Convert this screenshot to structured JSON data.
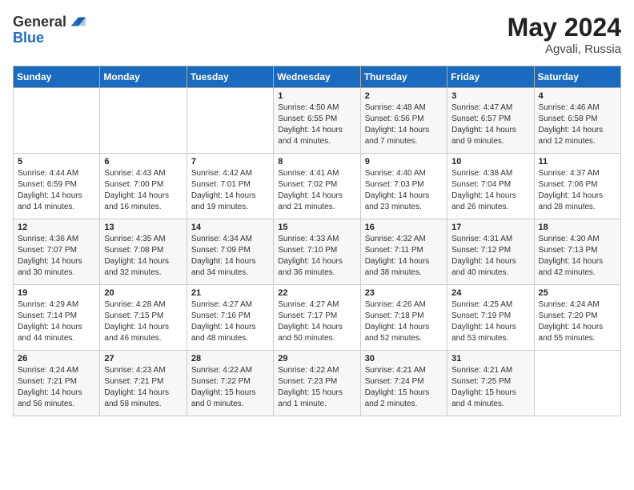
{
  "header": {
    "logo_general": "General",
    "logo_blue": "Blue",
    "title": "May 2024",
    "location": "Agvali, Russia"
  },
  "days_of_week": [
    "Sunday",
    "Monday",
    "Tuesday",
    "Wednesday",
    "Thursday",
    "Friday",
    "Saturday"
  ],
  "weeks": [
    [
      {
        "day": "",
        "content": ""
      },
      {
        "day": "",
        "content": ""
      },
      {
        "day": "",
        "content": ""
      },
      {
        "day": "1",
        "content": "Sunrise: 4:50 AM\nSunset: 6:55 PM\nDaylight: 14 hours and 4 minutes."
      },
      {
        "day": "2",
        "content": "Sunrise: 4:48 AM\nSunset: 6:56 PM\nDaylight: 14 hours and 7 minutes."
      },
      {
        "day": "3",
        "content": "Sunrise: 4:47 AM\nSunset: 6:57 PM\nDaylight: 14 hours and 9 minutes."
      },
      {
        "day": "4",
        "content": "Sunrise: 4:46 AM\nSunset: 6:58 PM\nDaylight: 14 hours and 12 minutes."
      }
    ],
    [
      {
        "day": "5",
        "content": "Sunrise: 4:44 AM\nSunset: 6:59 PM\nDaylight: 14 hours and 14 minutes."
      },
      {
        "day": "6",
        "content": "Sunrise: 4:43 AM\nSunset: 7:00 PM\nDaylight: 14 hours and 16 minutes."
      },
      {
        "day": "7",
        "content": "Sunrise: 4:42 AM\nSunset: 7:01 PM\nDaylight: 14 hours and 19 minutes."
      },
      {
        "day": "8",
        "content": "Sunrise: 4:41 AM\nSunset: 7:02 PM\nDaylight: 14 hours and 21 minutes."
      },
      {
        "day": "9",
        "content": "Sunrise: 4:40 AM\nSunset: 7:03 PM\nDaylight: 14 hours and 23 minutes."
      },
      {
        "day": "10",
        "content": "Sunrise: 4:38 AM\nSunset: 7:04 PM\nDaylight: 14 hours and 26 minutes."
      },
      {
        "day": "11",
        "content": "Sunrise: 4:37 AM\nSunset: 7:06 PM\nDaylight: 14 hours and 28 minutes."
      }
    ],
    [
      {
        "day": "12",
        "content": "Sunrise: 4:36 AM\nSunset: 7:07 PM\nDaylight: 14 hours and 30 minutes."
      },
      {
        "day": "13",
        "content": "Sunrise: 4:35 AM\nSunset: 7:08 PM\nDaylight: 14 hours and 32 minutes."
      },
      {
        "day": "14",
        "content": "Sunrise: 4:34 AM\nSunset: 7:09 PM\nDaylight: 14 hours and 34 minutes."
      },
      {
        "day": "15",
        "content": "Sunrise: 4:33 AM\nSunset: 7:10 PM\nDaylight: 14 hours and 36 minutes."
      },
      {
        "day": "16",
        "content": "Sunrise: 4:32 AM\nSunset: 7:11 PM\nDaylight: 14 hours and 38 minutes."
      },
      {
        "day": "17",
        "content": "Sunrise: 4:31 AM\nSunset: 7:12 PM\nDaylight: 14 hours and 40 minutes."
      },
      {
        "day": "18",
        "content": "Sunrise: 4:30 AM\nSunset: 7:13 PM\nDaylight: 14 hours and 42 minutes."
      }
    ],
    [
      {
        "day": "19",
        "content": "Sunrise: 4:29 AM\nSunset: 7:14 PM\nDaylight: 14 hours and 44 minutes."
      },
      {
        "day": "20",
        "content": "Sunrise: 4:28 AM\nSunset: 7:15 PM\nDaylight: 14 hours and 46 minutes."
      },
      {
        "day": "21",
        "content": "Sunrise: 4:27 AM\nSunset: 7:16 PM\nDaylight: 14 hours and 48 minutes."
      },
      {
        "day": "22",
        "content": "Sunrise: 4:27 AM\nSunset: 7:17 PM\nDaylight: 14 hours and 50 minutes."
      },
      {
        "day": "23",
        "content": "Sunrise: 4:26 AM\nSunset: 7:18 PM\nDaylight: 14 hours and 52 minutes."
      },
      {
        "day": "24",
        "content": "Sunrise: 4:25 AM\nSunset: 7:19 PM\nDaylight: 14 hours and 53 minutes."
      },
      {
        "day": "25",
        "content": "Sunrise: 4:24 AM\nSunset: 7:20 PM\nDaylight: 14 hours and 55 minutes."
      }
    ],
    [
      {
        "day": "26",
        "content": "Sunrise: 4:24 AM\nSunset: 7:21 PM\nDaylight: 14 hours and 56 minutes."
      },
      {
        "day": "27",
        "content": "Sunrise: 4:23 AM\nSunset: 7:21 PM\nDaylight: 14 hours and 58 minutes."
      },
      {
        "day": "28",
        "content": "Sunrise: 4:22 AM\nSunset: 7:22 PM\nDaylight: 15 hours and 0 minutes."
      },
      {
        "day": "29",
        "content": "Sunrise: 4:22 AM\nSunset: 7:23 PM\nDaylight: 15 hours and 1 minute."
      },
      {
        "day": "30",
        "content": "Sunrise: 4:21 AM\nSunset: 7:24 PM\nDaylight: 15 hours and 2 minutes."
      },
      {
        "day": "31",
        "content": "Sunrise: 4:21 AM\nSunset: 7:25 PM\nDaylight: 15 hours and 4 minutes."
      },
      {
        "day": "",
        "content": ""
      }
    ]
  ]
}
